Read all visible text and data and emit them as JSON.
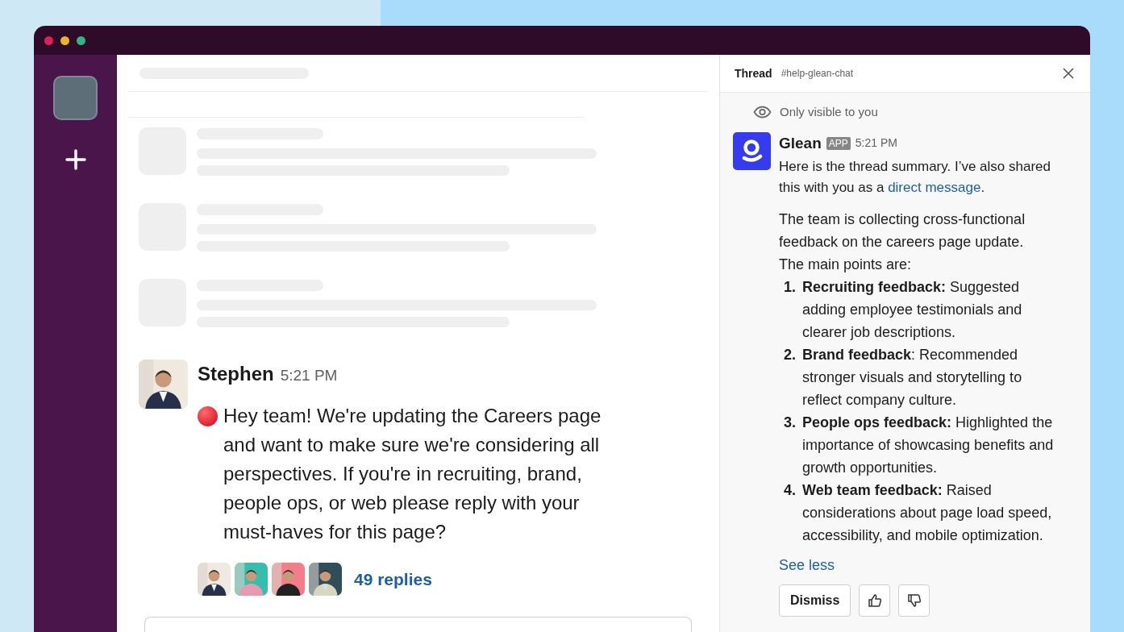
{
  "window": {
    "controls": [
      {
        "color": "#e01e5a"
      },
      {
        "color": "#ecb22e"
      },
      {
        "color": "#2eb67d"
      }
    ]
  },
  "message": {
    "author": "Stephen",
    "time": "5:21 PM",
    "text": "Hey team! We're updating the Careers page and want to make sure we're considering all perspectives. If you're in recruiting, brand, people ops, or web please reply with your must-haves for this page?",
    "replies": "49 replies"
  },
  "thread": {
    "title": "Thread",
    "channel": "#help-glean-chat",
    "notice": "Only visible to you",
    "reply": {
      "author": "Glean",
      "badge": "APP",
      "time": "5:21 PM",
      "intro": "Here is the thread summary. I’ve also shared this with you as a ",
      "link": "direct message",
      "intro_end": ".",
      "summary": "The team is collecting cross-functional feedback on the careers page update.",
      "points_heading": "The main points are:",
      "points": [
        {
          "number": "1.",
          "text": "**Recruiting feedback:** Suggested adding employee testimonials and clearer job descriptions."
        },
        {
          "number": "2.",
          "text": "**Brand feedback**: Recommended stronger visuals and storytelling to reflect company culture."
        },
        {
          "number": "3.",
          "text": "**People ops feedback:** Highlighted the importance of showcasing benefits and growth opportunities."
        },
        {
          "number": "4.",
          "text": "**Web team feedback:** Raised considerations about page load speed, accessibility, and mobile optimization."
        }
      ],
      "toggle": "See less",
      "dismiss": "Dismiss"
    }
  }
}
